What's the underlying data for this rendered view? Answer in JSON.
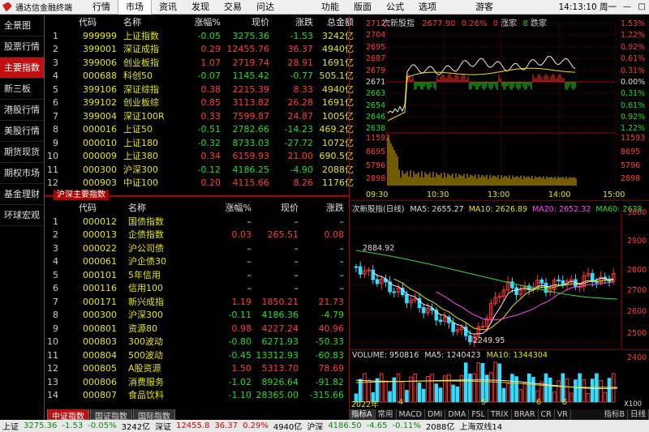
{
  "app": {
    "title": "通达信金融终端",
    "menus": [
      "行情",
      "市场",
      "资讯",
      "发现",
      "交易",
      "问达"
    ],
    "right_menus": [
      "功能",
      "版面",
      "公式",
      "选项"
    ],
    "user": "游客",
    "clock": "14:13:10 周一"
  },
  "sidebar": {
    "items": [
      "全景图",
      "股票行情",
      "主要指数",
      "新三板",
      "港股行情",
      "美股行情",
      "期货现货",
      "期权市场",
      "基金理财",
      "环球宏观"
    ]
  },
  "table1": {
    "headers": [
      "",
      "代码",
      "名称",
      "涨幅%",
      "现价",
      "涨跌",
      "总金额"
    ],
    "rows": [
      {
        "idx": "1",
        "code": "999999",
        "name": "上证指数",
        "pct": "-0.05",
        "price": "3275.36",
        "chg": "-1.53",
        "amt": "3242亿",
        "dir": "dn"
      },
      {
        "idx": "2",
        "code": "399001",
        "name": "深证成指",
        "pct": "0.29",
        "price": "12455.76",
        "chg": "36.37",
        "amt": "4940亿",
        "dir": "up"
      },
      {
        "idx": "3",
        "code": "399006",
        "name": "创业板指",
        "pct": "1.07",
        "price": "2719.74",
        "chg": "28.91",
        "amt": "1691亿",
        "dir": "up"
      },
      {
        "idx": "4",
        "code": "000688",
        "name": "科创50",
        "pct": "-0.07",
        "price": "1145.42",
        "chg": "-0.77",
        "amt": "505.1亿",
        "dir": "dn"
      },
      {
        "idx": "5",
        "code": "399106",
        "name": "深证综指",
        "pct": "0.38",
        "price": "2215.39",
        "chg": "8.33",
        "amt": "4940亿",
        "dir": "up"
      },
      {
        "idx": "6",
        "code": "399102",
        "name": "创业板综",
        "pct": "0.85",
        "price": "3113.82",
        "chg": "26.28",
        "amt": "1691亿",
        "dir": "up"
      },
      {
        "idx": "7",
        "code": "399004",
        "name": "深证100R",
        "pct": "0.33",
        "price": "7599.87",
        "chg": "24.87",
        "amt": "1005亿",
        "dir": "up"
      },
      {
        "idx": "8",
        "code": "000016",
        "name": "上证50",
        "pct": "-0.51",
        "price": "2782.66",
        "chg": "-14.23",
        "amt": "469.2亿",
        "dir": "dn"
      },
      {
        "idx": "9",
        "code": "000010",
        "name": "上证180",
        "pct": "-0.32",
        "price": "8733.03",
        "chg": "-27.72",
        "amt": "1072亿",
        "dir": "dn"
      },
      {
        "idx": "10",
        "code": "000009",
        "name": "上证380",
        "pct": "0.34",
        "price": "6159.93",
        "chg": "21.00",
        "amt": "690.5亿",
        "dir": "up"
      },
      {
        "idx": "11",
        "code": "000300",
        "name": "沪深300",
        "pct": "-0.12",
        "price": "4186.25",
        "chg": "-4.90",
        "amt": "2088亿",
        "dir": "dn"
      },
      {
        "idx": "12",
        "code": "000903",
        "name": "中证100",
        "pct": "0.20",
        "price": "4115.66",
        "chg": "8.26",
        "amt": "1176亿",
        "dir": "up"
      }
    ]
  },
  "section1_label": "沪深主要指数",
  "table2": {
    "headers": [
      "",
      "代码",
      "名称",
      "涨幅%",
      "现价",
      "涨跌"
    ],
    "rows": [
      {
        "idx": "1",
        "code": "000012",
        "name": "国债指数",
        "pct": "–",
        "price": "–",
        "chg": "–",
        "dir": "fl"
      },
      {
        "idx": "2",
        "code": "000013",
        "name": "企债指数",
        "pct": "0.03",
        "price": "265.51",
        "chg": "0.08",
        "dir": "up"
      },
      {
        "idx": "3",
        "code": "000022",
        "name": "沪公司债",
        "pct": "–",
        "price": "–",
        "chg": "–",
        "dir": "fl"
      },
      {
        "idx": "4",
        "code": "000061",
        "name": "沪企债30",
        "pct": "–",
        "price": "–",
        "chg": "–",
        "dir": "fl"
      },
      {
        "idx": "5",
        "code": "000101",
        "name": "5年信用",
        "pct": "–",
        "price": "–",
        "chg": "–",
        "dir": "fl"
      },
      {
        "idx": "6",
        "code": "000116",
        "name": "信用100",
        "pct": "–",
        "price": "–",
        "chg": "–",
        "dir": "fl"
      },
      {
        "idx": "7",
        "code": "000171",
        "name": "新兴成指",
        "pct": "1.19",
        "price": "1850.21",
        "chg": "21.73",
        "dir": "up"
      },
      {
        "idx": "8",
        "code": "000300",
        "name": "沪深300",
        "pct": "-0.11",
        "price": "4186.36",
        "chg": "-4.79",
        "dir": "dn"
      },
      {
        "idx": "9",
        "code": "000801",
        "name": "资源80",
        "pct": "0.98",
        "price": "4227.24",
        "chg": "40.96",
        "dir": "up"
      },
      {
        "idx": "10",
        "code": "000803",
        "name": "300波动",
        "pct": "-0.80",
        "price": "6271.93",
        "chg": "-50.33",
        "dir": "dn"
      },
      {
        "idx": "11",
        "code": "000804",
        "name": "500波动",
        "pct": "-0.45",
        "price": "13312.93",
        "chg": "-60.83",
        "dir": "dn"
      },
      {
        "idx": "12",
        "code": "000805",
        "name": "A股资源",
        "pct": "1.50",
        "price": "5313.70",
        "chg": "78.69",
        "dir": "up"
      },
      {
        "idx": "13",
        "code": "000806",
        "name": "消费服务",
        "pct": "-1.02",
        "price": "8926.64",
        "chg": "-91.82",
        "dir": "dn"
      },
      {
        "idx": "14",
        "code": "000807",
        "name": "食品饮料",
        "pct": "-1.10",
        "price": "28365.00",
        "chg": "-315.66",
        "dir": "dn"
      }
    ]
  },
  "bottom_tabs": [
    "中证指数",
    "国证指数",
    "国际指数"
  ],
  "intraday": {
    "name": "次新股指",
    "price": "2677.90",
    "pct": "0.26%",
    "up_label": "涨家",
    "up_count": "0",
    "down_label": "跌家",
    "down_count": "8",
    "left_labels": [
      "2712",
      "2704",
      "2695",
      "2687",
      "2679",
      "2671",
      "2663",
      "2654",
      "2646",
      "2638",
      "11593",
      "8695",
      "5796",
      "2898"
    ],
    "right_labels": [
      "1.53%",
      "1.22%",
      "0.92%",
      "0.61%",
      "0.31%",
      "0.00%",
      "0.31%",
      "0.61%",
      "0.92%",
      "1.22%",
      "11593",
      "8695",
      "5796",
      "2898"
    ],
    "times": [
      "09:30",
      "10:30",
      "13:00",
      "14:00",
      "15:00"
    ]
  },
  "kline": {
    "title": "次新股指(日线)",
    "ma5_label": "MA5: 2655.27",
    "ma10_label": "MA10: 2626.89",
    "ma20_label": "MA20: 2652.32",
    "ma60_label": "MA60: 2638",
    "y_labels": [
      "3000",
      "2900",
      "2800",
      "2700",
      "2600",
      "2500",
      "2400"
    ],
    "high_mark": "2884.92",
    "low_mark": "2249.95"
  },
  "volume": {
    "title": "VOLUME: 950816",
    "ma5_label": "MA5: 1240423",
    "ma10_label": "MA10: 1344304",
    "x_labels": [
      "2022年",
      "4",
      "5",
      "6",
      "8"
    ],
    "unit_label": "X100"
  },
  "indicator_tabs": [
    "指标A",
    "常用",
    "MACD",
    "DMI",
    "DMA",
    "FSL",
    "TRIX",
    "BRAR",
    "CR",
    "VR"
  ],
  "indicator_right": [
    "指标B",
    "日线"
  ],
  "statusbar": [
    {
      "t": "上证",
      "c": "#000"
    },
    {
      "t": "3275.36",
      "c": "#0a8a0a"
    },
    {
      "t": "-1.53",
      "c": "#0a8a0a"
    },
    {
      "t": "-0.05%",
      "c": "#0a8a0a"
    },
    {
      "t": "3242亿",
      "c": "#000"
    },
    {
      "t": "深证",
      "c": "#000"
    },
    {
      "t": "12455.8",
      "c": "#d00"
    },
    {
      "t": "36.37",
      "c": "#d00"
    },
    {
      "t": "0.29%",
      "c": "#d00"
    },
    {
      "t": "4940亿",
      "c": "#000"
    },
    {
      "t": "沪深",
      "c": "#000"
    },
    {
      "t": "4186.50",
      "c": "#0a8a0a"
    },
    {
      "t": "-4.65",
      "c": "#0a8a0a"
    },
    {
      "t": "-0.11%",
      "c": "#0a8a0a"
    },
    {
      "t": "2088亿",
      "c": "#000"
    },
    {
      "t": "上海双线14",
      "c": "#000"
    }
  ]
}
